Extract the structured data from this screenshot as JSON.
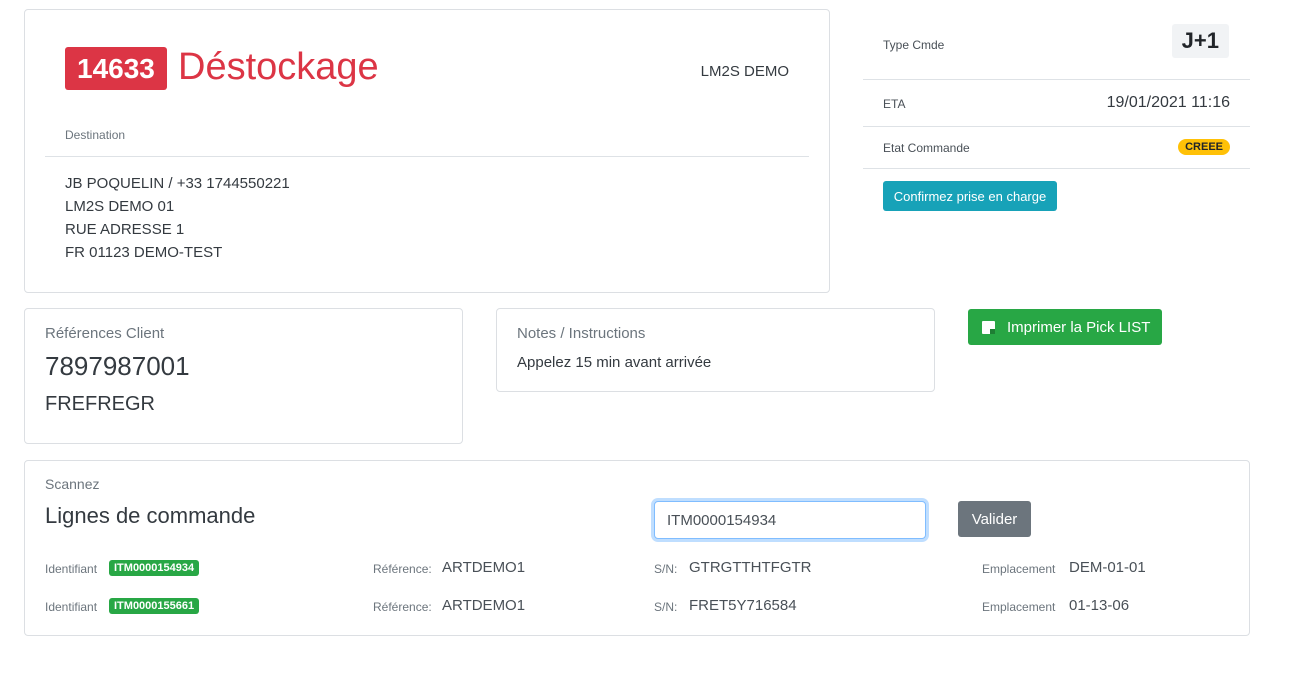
{
  "order": {
    "number": "14633",
    "title": "Déstockage",
    "client": "LM2S DEMO",
    "destination_label": "Destination",
    "address": [
      "JB POQUELIN / +33 1744550221",
      "LM2S DEMO 01",
      "RUE ADRESSE 1",
      "FR 01123 DEMO-TEST"
    ]
  },
  "info": {
    "type_label": "Type Cmde",
    "type_value": "J+1",
    "eta_label": "ETA",
    "eta_value": "19/01/2021 11:16",
    "etat_label": "Etat Commande",
    "etat_value": "CREEE",
    "etat_color": "#ffc107",
    "confirm_label": "Confirmez prise en charge"
  },
  "refs": {
    "label": "Références Client",
    "main": "7897987001",
    "sub": "FREFREGR"
  },
  "notes": {
    "label": "Notes / Instructions",
    "text": "Appelez 15 min avant arrivée"
  },
  "print_label": "Imprimer la Pick LIST",
  "lines": {
    "scan_label": "Scannez",
    "title": "Lignes de commande",
    "scan_value": "ITM0000154934",
    "validate_label": "Valider",
    "id_label": "Identifiant",
    "ref_label": "Référence:",
    "sn_label": "S/N:",
    "loc_label": "Emplacement",
    "rows": [
      {
        "id": "ITM0000154934",
        "ref": "ARTDEMO1",
        "sn": "GTRGTTHTFGTR",
        "loc": "DEM-01-01"
      },
      {
        "id": "ITM0000155661",
        "ref": "ARTDEMO1",
        "sn": "FRET5Y716584",
        "loc": "01-13-06"
      }
    ]
  },
  "colors": {
    "danger": "#dc3545",
    "info": "#17a2b8",
    "success": "#28a745",
    "secondary": "#6c757d"
  }
}
